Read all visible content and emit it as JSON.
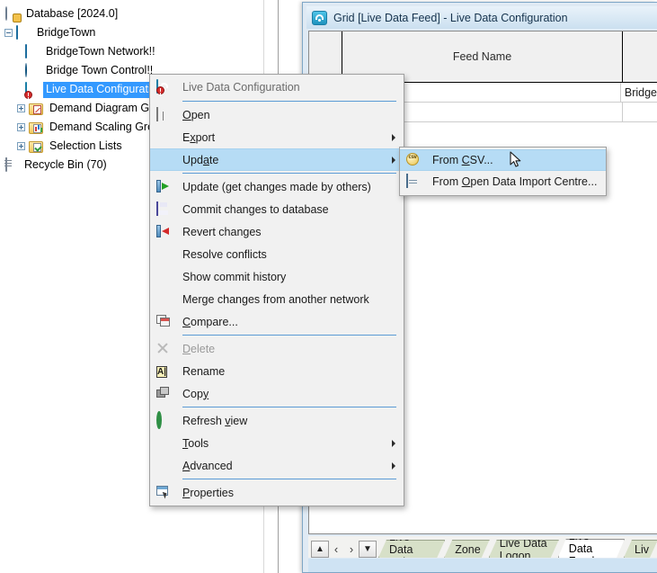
{
  "tree": {
    "nodes": [
      {
        "label": "Database [2024.0]",
        "icon": "database-icon",
        "level": 0,
        "expander": "none",
        "selected": false
      },
      {
        "label": "BridgeTown",
        "icon": "network-group-icon",
        "level": 1,
        "expander": "minus",
        "selected": false
      },
      {
        "label": "BridgeTown Network!!",
        "icon": "network-icon",
        "level": 2,
        "expander": "none",
        "selected": false
      },
      {
        "label": "Bridge Town Control!!",
        "icon": "control-icon",
        "level": 2,
        "expander": "none",
        "selected": false
      },
      {
        "label": "Live Data Configuration",
        "icon": "live-data-icon",
        "level": 2,
        "expander": "none",
        "selected": true
      },
      {
        "label": "Demand Diagram Groups",
        "icon": "folder-demand-diagram-icon",
        "level": 2,
        "expander": "plus",
        "selected": false
      },
      {
        "label": "Demand Scaling Groups",
        "icon": "folder-demand-scaling-icon",
        "level": 2,
        "expander": "plus",
        "selected": false
      },
      {
        "label": "Selection Lists",
        "icon": "folder-selection-lists-icon",
        "level": 2,
        "expander": "plus",
        "selected": false
      },
      {
        "label": "Recycle Bin (70)",
        "icon": "recycle-bin-icon",
        "level": 0,
        "expander": "none",
        "selected": false
      }
    ]
  },
  "grid_window": {
    "title": "Grid [Live Data Feed] - Live Data Configuration",
    "title_icon": "live-data-icon",
    "columns": [
      "",
      "Feed Name",
      ""
    ],
    "rows": [
      [
        "",
        "",
        "Bridge"
      ],
      [
        "",
        "",
        ""
      ]
    ],
    "tab_nav": {
      "first_label": "▲",
      "prev_label": "‹",
      "next_label": "›",
      "last_label": "▼"
    },
    "tabs": [
      {
        "label": "Live Data Point",
        "active": false
      },
      {
        "label": "Zone",
        "active": false
      },
      {
        "label": "Live Data Logon",
        "active": false
      },
      {
        "label": "Live Data Feed",
        "active": true
      },
      {
        "label": "Liv",
        "active": false
      }
    ]
  },
  "context_menu": {
    "header": {
      "label": "Live Data Configuration",
      "icon": "live-data-icon"
    },
    "items": [
      {
        "label": "Open",
        "accel": "O",
        "icon": "open-icon",
        "submenu": false,
        "disabled": false,
        "highlighted": false
      },
      {
        "label": "Export",
        "accel": "x",
        "icon": "none",
        "submenu": true,
        "disabled": false,
        "highlighted": false
      },
      {
        "label": "Update",
        "accel": "a",
        "icon": "none",
        "submenu": true,
        "disabled": false,
        "highlighted": true
      },
      {
        "label": "Update (get changes made by others)",
        "accel": "",
        "icon": "update-arrow-icon",
        "submenu": false,
        "disabled": false,
        "highlighted": false
      },
      {
        "label": "Commit changes to database",
        "accel": "",
        "icon": "save-icon",
        "submenu": false,
        "disabled": false,
        "highlighted": false
      },
      {
        "label": "Revert changes",
        "accel": "",
        "icon": "revert-icon",
        "submenu": false,
        "disabled": false,
        "highlighted": false
      },
      {
        "label": "Resolve conflicts",
        "accel": "",
        "icon": "none",
        "submenu": false,
        "disabled": false,
        "highlighted": false
      },
      {
        "label": "Show commit history",
        "accel": "",
        "icon": "none",
        "submenu": false,
        "disabled": false,
        "highlighted": false
      },
      {
        "label": "Merge changes from another network",
        "accel": "",
        "icon": "none",
        "submenu": false,
        "disabled": false,
        "highlighted": false
      },
      {
        "label": "Compare...",
        "accel": "C",
        "icon": "compare-icon",
        "submenu": false,
        "disabled": false,
        "highlighted": false
      },
      {
        "label": "Delete",
        "accel": "D",
        "icon": "delete-icon",
        "submenu": false,
        "disabled": true,
        "highlighted": false
      },
      {
        "label": "Rename",
        "accel": "",
        "icon": "rename-icon",
        "submenu": false,
        "disabled": false,
        "highlighted": false
      },
      {
        "label": "Copy",
        "accel": "y",
        "icon": "copy-icon",
        "submenu": false,
        "disabled": false,
        "highlighted": false
      },
      {
        "label": "Refresh view",
        "accel": "v",
        "icon": "refresh-icon",
        "submenu": false,
        "disabled": false,
        "highlighted": false
      },
      {
        "label": "Tools",
        "accel": "T",
        "icon": "none",
        "submenu": true,
        "disabled": false,
        "highlighted": false
      },
      {
        "label": "Advanced",
        "accel": "A",
        "icon": "none",
        "submenu": true,
        "disabled": false,
        "highlighted": false
      },
      {
        "label": "Properties",
        "accel": "P",
        "icon": "properties-icon",
        "submenu": false,
        "disabled": false,
        "highlighted": false
      }
    ]
  },
  "sub_menu": {
    "items": [
      {
        "label": "From CSV...",
        "icon": "csv-icon",
        "highlighted": true
      },
      {
        "label": "From Open Data Import Centre...",
        "icon": "odic-icon",
        "highlighted": false
      }
    ]
  },
  "colors": {
    "highlight": "#b6dcf5",
    "tree_selection": "#3399ff",
    "separator": "#5b9bd5",
    "tab_inactive": "#d7e0c8",
    "window_frame": "#dfeaf4"
  }
}
